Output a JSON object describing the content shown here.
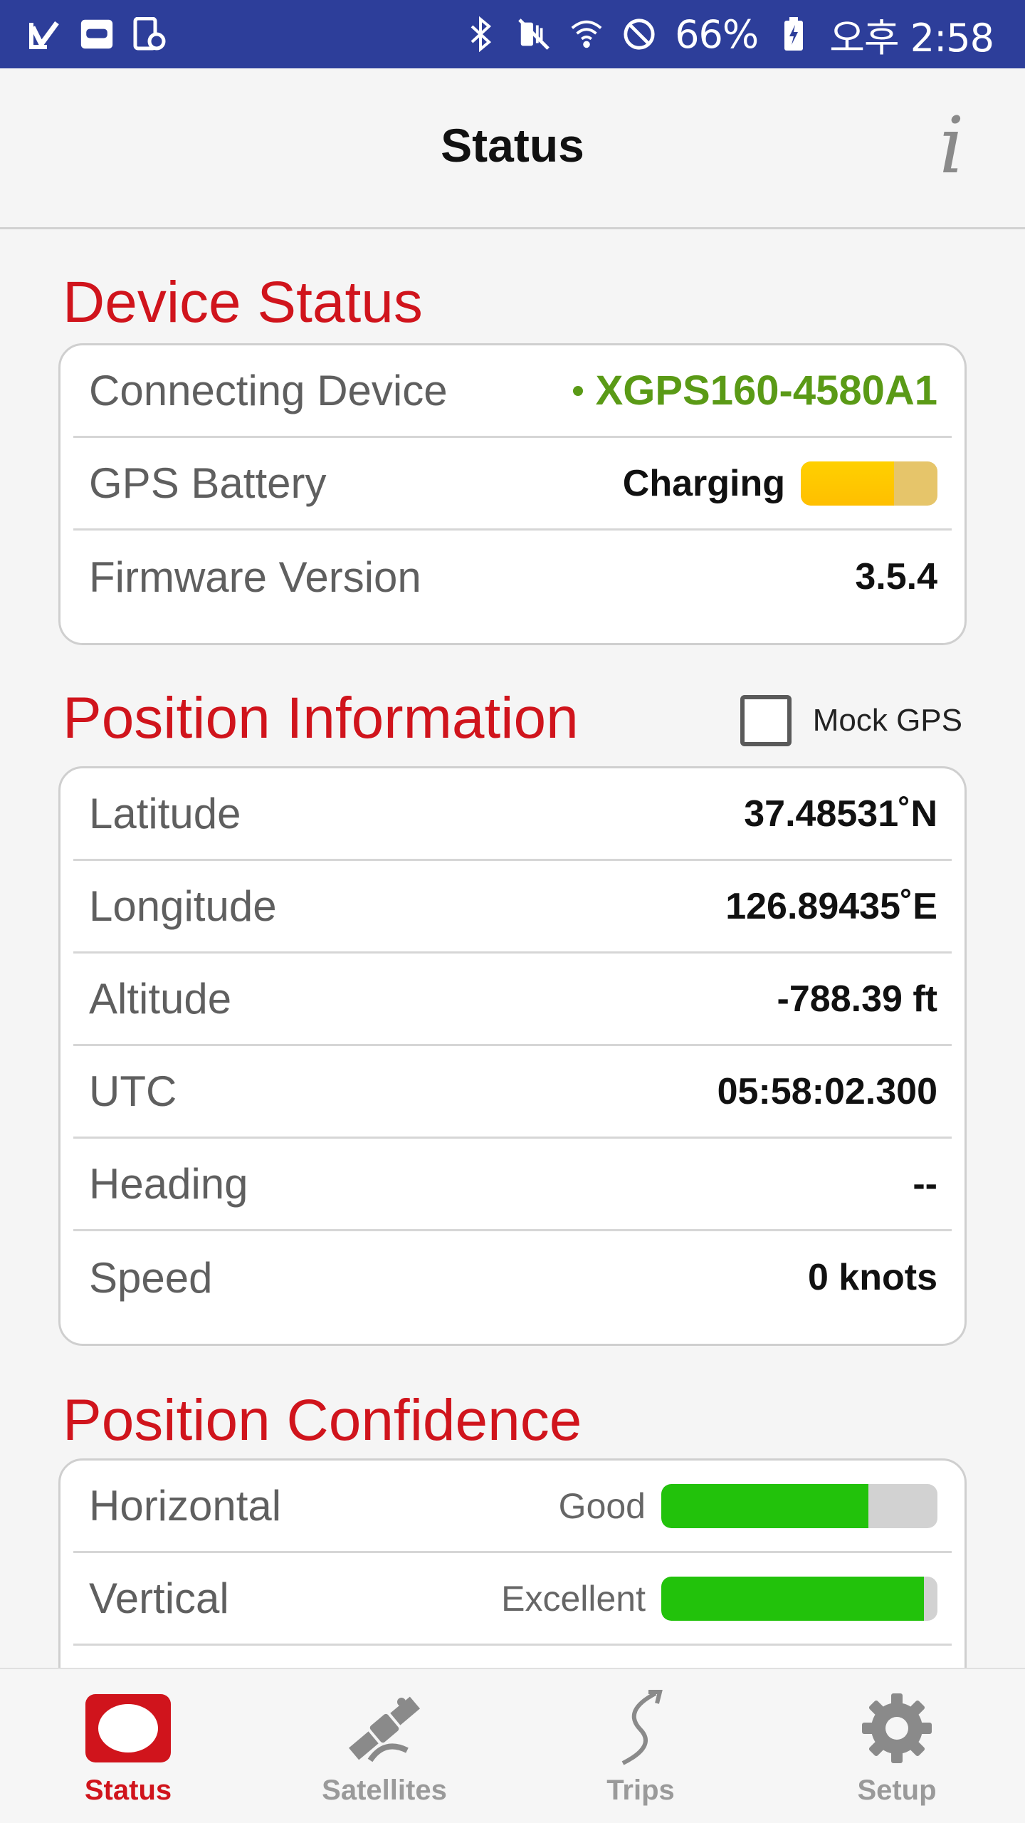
{
  "status_bar": {
    "battery_percent": "66%",
    "time": "오후 2:58",
    "left_icons": [
      "check-icon",
      "vr-icon",
      "device-icon"
    ],
    "right_icons": [
      "bluetooth-icon",
      "mute-icon",
      "wifi-icon",
      "dnd-icon",
      "battery-charging-icon"
    ]
  },
  "header": {
    "title": "Status",
    "info_label": "i"
  },
  "device_status": {
    "title": "Device Status",
    "rows": {
      "connecting": {
        "label": "Connecting Device",
        "value": "XGPS160-4580A1"
      },
      "battery": {
        "label": "GPS Battery",
        "value": "Charging",
        "level": 0.68
      },
      "firmware": {
        "label": "Firmware Version",
        "value": "3.5.4"
      }
    }
  },
  "position_info": {
    "title": "Position Information",
    "mock_gps": {
      "label": "Mock GPS",
      "checked": false
    },
    "rows": {
      "latitude": {
        "label": "Latitude",
        "value": "37.48531˚N"
      },
      "longitude": {
        "label": "Longitude",
        "value": "126.89435˚E"
      },
      "altitude": {
        "label": "Altitude",
        "value": "-788.39 ft"
      },
      "utc": {
        "label": "UTC",
        "value": "05:58:02.300"
      },
      "heading": {
        "label": "Heading",
        "value": "--"
      },
      "speed": {
        "label": "Speed",
        "value": "0 knots"
      }
    }
  },
  "position_confidence": {
    "title": "Position Confidence",
    "rows": {
      "horizontal": {
        "label": "Horizontal",
        "rating": "Good",
        "level": 0.75
      },
      "vertical": {
        "label": "Vertical",
        "rating": "Excellent",
        "level": 0.95
      }
    }
  },
  "bottom_nav": {
    "tabs": [
      {
        "label": "Status",
        "icon": "status-icon",
        "active": true
      },
      {
        "label": "Satellites",
        "icon": "satellite-icon",
        "active": false
      },
      {
        "label": "Trips",
        "icon": "trips-icon",
        "active": false
      },
      {
        "label": "Setup",
        "icon": "gear-icon",
        "active": false
      }
    ]
  },
  "colors": {
    "status_bar": "#2d3e9a",
    "accent_red": "#d0141c",
    "device_green": "#5a9a16",
    "confidence_green": "#22c20b",
    "battery_yellow": "#ffc800"
  }
}
